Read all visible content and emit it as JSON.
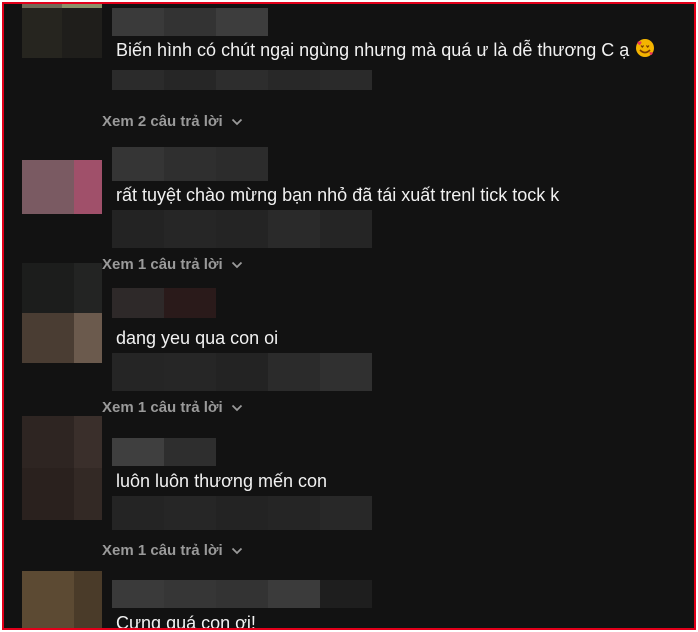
{
  "comments": [
    {
      "text": "Biến hình có chút ngại ngùng nhưng mà quá ư là dễ thương C ạ",
      "emoji": "smiling-face-with-hearts",
      "replies_label": "Xem 2 câu trả lời"
    },
    {
      "text": "rất tuyệt chào mừng bạn nhỏ đã tái xuất trenl tick tock k",
      "replies_label": "Xem 1 câu trả lời"
    },
    {
      "text": "dang yeu qua con oi",
      "replies_label": "Xem 1 câu trả lời"
    },
    {
      "text": "luôn luôn thương mến con",
      "replies_label": "Xem 1 câu trả lời"
    },
    {
      "text": "Cưng quá con ơi!"
    }
  ],
  "colors": {
    "background": "#121212",
    "text": "#f1f1f1",
    "replies": "#9a9a9a",
    "frame_border": "#e2001a"
  }
}
